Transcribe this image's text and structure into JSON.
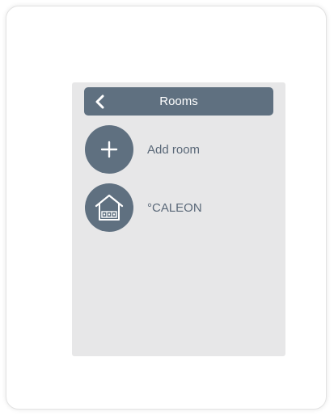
{
  "header": {
    "title": "Rooms"
  },
  "rooms": {
    "add_label": "Add room",
    "items": [
      {
        "label": "°CALEON",
        "icon": "house-thermostat-icon"
      }
    ]
  },
  "icons": {
    "back": "chevron-left-icon",
    "add": "plus-icon"
  },
  "colors": {
    "accent": "#5f7080",
    "screen_background": "#e7e7e8",
    "label_text": "#5a6878",
    "header_text": "#ffffff"
  }
}
